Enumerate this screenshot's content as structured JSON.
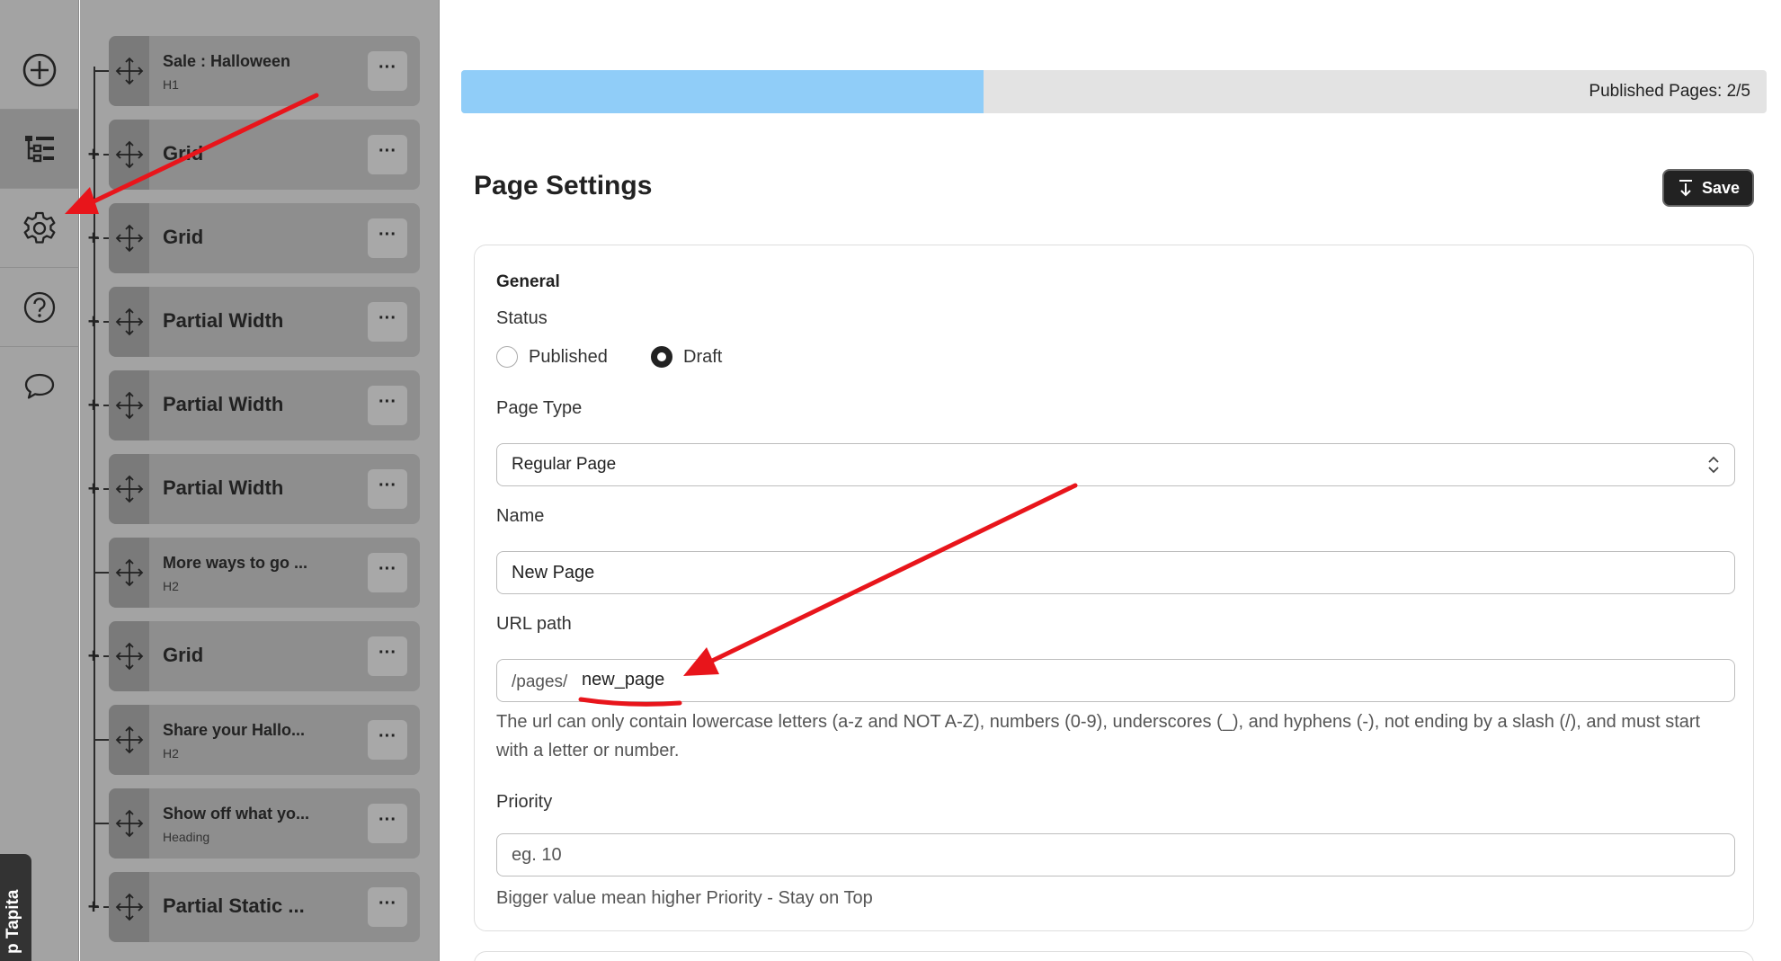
{
  "rail": {
    "items": [
      {
        "name": "add",
        "icon": "plus-circle-icon"
      },
      {
        "name": "layers",
        "icon": "layers-tree-icon"
      },
      {
        "name": "settings",
        "icon": "gear-icon"
      },
      {
        "name": "help",
        "icon": "question-circle-icon"
      },
      {
        "name": "comments",
        "icon": "chat-bubble-icon"
      }
    ],
    "feedback_label": "p Tapita"
  },
  "layers": [
    {
      "title": "Sale : Halloween",
      "subtitle": "H1",
      "more": "···"
    },
    {
      "title": "Grid",
      "subtitle": "",
      "more": "···"
    },
    {
      "title": "Grid",
      "subtitle": "",
      "more": "···"
    },
    {
      "title": "Partial Width",
      "subtitle": "",
      "more": "···"
    },
    {
      "title": "Partial Width",
      "subtitle": "",
      "more": "···"
    },
    {
      "title": "Partial Width",
      "subtitle": "",
      "more": "···"
    },
    {
      "title": "More ways to go ...",
      "subtitle": "H2",
      "more": "···"
    },
    {
      "title": "Grid",
      "subtitle": "",
      "more": "···"
    },
    {
      "title": "Share your Hallo...",
      "subtitle": "H2",
      "more": "···"
    },
    {
      "title": "Show off what yo...",
      "subtitle": "Heading",
      "more": "···"
    },
    {
      "title": "Partial Static ...",
      "subtitle": "",
      "more": "···"
    }
  ],
  "progress": {
    "label": "Published Pages: 2/5",
    "fraction": 0.4,
    "color": "#90cdf8"
  },
  "settings": {
    "title": "Page Settings",
    "save_label": "Save",
    "section_label": "General",
    "status_label": "Status",
    "status_options": [
      "Published",
      "Draft"
    ],
    "status_selected": "Draft",
    "page_type_label": "Page Type",
    "page_type_value": "Regular Page",
    "name_label": "Name",
    "name_value": "New Page",
    "url_label": "URL path",
    "url_prefix": "/pages/",
    "url_value": "new_page",
    "url_help": "The url can only contain lowercase letters (a-z and NOT A-Z), numbers (0-9), underscores (_), and hyphens (-), not ending by a slash (/), and must start with a letter or number.",
    "priority_label": "Priority",
    "priority_placeholder": "eg. 10",
    "priority_help": "Bigger value mean higher Priority - Stay on Top"
  },
  "colors": {
    "annotation": "#e8151b",
    "accent": "#90cdf8"
  }
}
